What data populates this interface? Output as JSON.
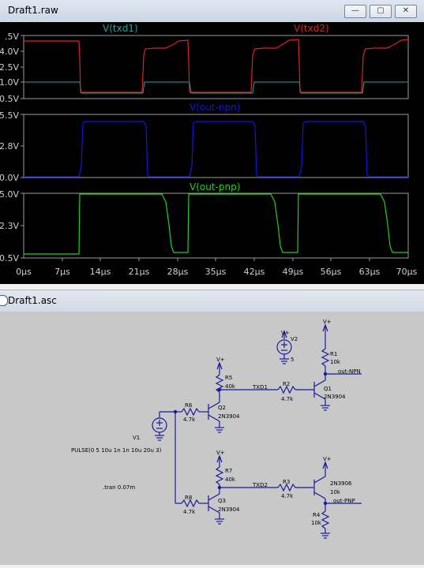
{
  "plot_window": {
    "title": "Draft1.raw",
    "buttons": {
      "minimize": "—",
      "maximize": "▢",
      "close": "✕"
    },
    "panes": [
      {
        "traces": [
          {
            "name": "V(txd1)",
            "color": "#1fa3a3"
          },
          {
            "name": "V(txd2)",
            "color": "#e02020"
          }
        ],
        "y_ticks": [
          ".5V",
          "4.0V",
          "2.5V",
          "1.0V",
          "0.5V"
        ]
      },
      {
        "traces": [
          {
            "name": "V(out-npn)",
            "color": "#1414e0"
          }
        ],
        "y_ticks": [
          "5.5V",
          "2.8V",
          "0.0V"
        ]
      },
      {
        "traces": [
          {
            "name": "V(out-pnp)",
            "color": "#22d022"
          }
        ],
        "y_ticks": [
          "5.0V",
          "2.3V",
          "0.5V"
        ]
      }
    ],
    "x_ticks": [
      "0µs",
      "7µs",
      "14µs",
      "21µs",
      "28µs",
      "35µs",
      "42µs",
      "49µs",
      "56µs",
      "63µs",
      "70µs"
    ]
  },
  "schematic_window": {
    "title": "Draft1.asc",
    "labels": {
      "v2": "V2",
      "v2_val": "5",
      "v1": "V1",
      "v1_val": "PULSE(0 5 10u 1n 1n 10u 20u 3)",
      "tran": ".tran 0.07m",
      "vplus": "V+",
      "r1": "R1",
      "r1_val": "10k",
      "r2": "R2",
      "r2_val": "4.7k",
      "r3": "R3",
      "r3_val": "4.7k",
      "r4": "R4",
      "r4_val": "10k",
      "r5": "R5",
      "r5_val": "40k",
      "r6": "R6",
      "r6_val": "4.7k",
      "r7": "R7",
      "r7_val": "40k",
      "r8": "R8",
      "r8_val": "4.7k",
      "q1": "Q1",
      "q1_val": "2N3904",
      "q2": "Q2",
      "q2_val": "2N3904",
      "q3": "Q3",
      "q3_val": "2N3904",
      "q4_val": "2N3906",
      "q4_extra": "10k",
      "net_txd1": "TXD1",
      "net_txd2": "TXD2",
      "net_out_npn": "out-NPN",
      "net_out_pnp": "out-PNP"
    }
  }
}
